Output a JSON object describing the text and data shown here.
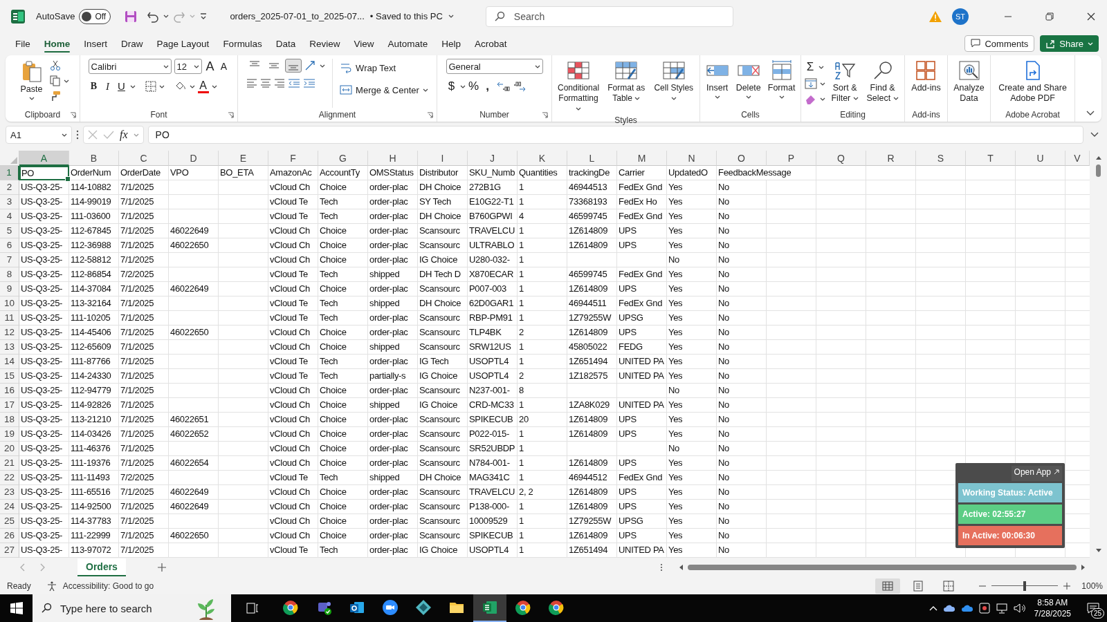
{
  "title_bar": {
    "autosave_label": "AutoSave",
    "autosave_on": false,
    "autosave_state": "Off",
    "file_name": "orders_2025-07-01_to_2025-07...",
    "save_status": "• Saved to this PC",
    "search_placeholder": "Search",
    "user_initials": "ST"
  },
  "menu_tabs": [
    {
      "label": "File",
      "selected": false
    },
    {
      "label": "Home",
      "selected": true
    },
    {
      "label": "Insert",
      "selected": false
    },
    {
      "label": "Draw",
      "selected": false
    },
    {
      "label": "Page Layout",
      "selected": false
    },
    {
      "label": "Formulas",
      "selected": false
    },
    {
      "label": "Data",
      "selected": false
    },
    {
      "label": "Review",
      "selected": false
    },
    {
      "label": "View",
      "selected": false
    },
    {
      "label": "Automate",
      "selected": false
    },
    {
      "label": "Help",
      "selected": false
    },
    {
      "label": "Acrobat",
      "selected": false
    }
  ],
  "comments_button": "Comments",
  "share_button": "Share",
  "ribbon": [
    {
      "kind": "clipboard",
      "label": "Clipboard",
      "paste": "Paste"
    },
    {
      "kind": "font",
      "label": "Font",
      "font_name": "Calibri",
      "font_size": "12",
      "grow": "A",
      "shrink": "A",
      "bold": "B",
      "italic": "I",
      "underline": "U",
      "font_color": "A"
    },
    {
      "kind": "alignment",
      "label": "Alignment",
      "vertical_align": [
        {
          "selected": false
        },
        {
          "selected": false
        },
        {
          "selected": true
        }
      ],
      "wrap_text": "Wrap Text",
      "merge_center": "Merge & Center"
    },
    {
      "kind": "number",
      "label": "Number",
      "format": "General",
      "currency": "$",
      "percent": "%",
      "comma": ","
    },
    {
      "kind": "styles",
      "label": "Styles",
      "buttons": [
        "Conditional Formatting",
        "Format as Table",
        "Cell Styles"
      ]
    },
    {
      "kind": "cells",
      "label": "Cells",
      "buttons": [
        "Insert",
        "Delete",
        "Format"
      ]
    },
    {
      "kind": "editing",
      "label": "Editing",
      "autosum": "Σ",
      "buttons": [
        "Sort & Filter",
        "Find & Select"
      ]
    },
    {
      "kind": "addins",
      "label": "Add-ins",
      "button": "Add-ins"
    },
    {
      "kind": "analyze",
      "button": "Analyze Data"
    },
    {
      "kind": "acrobat",
      "label": "Adobe Acrobat",
      "button": "Create and Share Adobe PDF"
    }
  ],
  "formula_bar": {
    "name_box": "A1",
    "fx": "fx",
    "content": "PO"
  },
  "sheet": {
    "columns": [
      {
        "label": "A",
        "selected": true
      },
      {
        "label": "B",
        "selected": false
      },
      {
        "label": "C",
        "selected": false
      },
      {
        "label": "D",
        "selected": false
      },
      {
        "label": "E",
        "selected": false
      },
      {
        "label": "F",
        "selected": false
      },
      {
        "label": "G",
        "selected": false
      },
      {
        "label": "H",
        "selected": false
      },
      {
        "label": "I",
        "selected": false
      },
      {
        "label": "J",
        "selected": false
      },
      {
        "label": "K",
        "selected": false
      },
      {
        "label": "L",
        "selected": false
      },
      {
        "label": "M",
        "selected": false
      },
      {
        "label": "N",
        "selected": false
      },
      {
        "label": "O",
        "selected": false
      },
      {
        "label": "P",
        "selected": false
      },
      {
        "label": "Q",
        "selected": false
      },
      {
        "label": "R",
        "selected": false
      },
      {
        "label": "S",
        "selected": false
      },
      {
        "label": "T",
        "selected": false
      },
      {
        "label": "U",
        "selected": false
      },
      {
        "label": "V",
        "selected": false
      }
    ],
    "rows": [
      {
        "number": "1",
        "selected": true,
        "cells": [
          "PO",
          "OrderNum",
          "OrderDate",
          "VPO",
          "BO_ETA",
          "AmazonAc",
          "AccountTy",
          "OMSStatus",
          "Distributor",
          "SKU_Numb",
          "Quantities",
          "trackingDe",
          "Carrier",
          "UpdatedO",
          "FeedbackMessage"
        ]
      },
      {
        "number": "2",
        "selected": false,
        "cells": [
          "US-Q3-25-",
          "114-10882",
          "7/1/2025",
          null,
          null,
          "vCloud Ch",
          "Choice",
          "order-plac",
          "DH Choice",
          "272B1G",
          "1",
          "46944513",
          "FedEx Gnd",
          "Yes",
          "No"
        ]
      },
      {
        "number": "3",
        "selected": false,
        "cells": [
          "US-Q3-25-",
          "114-99019",
          "7/1/2025",
          null,
          null,
          "vCloud Te",
          "Tech",
          "order-plac",
          "SY Tech",
          "E10G22-T1",
          "1",
          "73368193",
          "FedEx Ho",
          "Yes",
          "No"
        ]
      },
      {
        "number": "4",
        "selected": false,
        "cells": [
          "US-Q3-25-",
          "111-03600",
          "7/1/2025",
          null,
          null,
          "vCloud Te",
          "Tech",
          "order-plac",
          "DH Choice",
          "B760GPWI",
          "4",
          "46599745",
          "FedEx Gnd",
          "Yes",
          "No"
        ]
      },
      {
        "number": "5",
        "selected": false,
        "cells": [
          "US-Q3-25-",
          "112-67845",
          "7/1/2025",
          "46022649",
          null,
          "vCloud Ch",
          "Choice",
          "order-plac",
          "Scansourc",
          "TRAVELCU",
          "1",
          "1Z614809",
          "UPS",
          "Yes",
          "No"
        ]
      },
      {
        "number": "6",
        "selected": false,
        "cells": [
          "US-Q3-25-",
          "112-36988",
          "7/1/2025",
          "46022650",
          null,
          "vCloud Ch",
          "Choice",
          "order-plac",
          "Scansourc",
          "ULTRABLO",
          "1",
          "1Z614809",
          "UPS",
          "Yes",
          "No"
        ]
      },
      {
        "number": "7",
        "selected": false,
        "cells": [
          "US-Q3-25-",
          "112-58812",
          "7/1/2025",
          null,
          null,
          "vCloud Ch",
          "Choice",
          "order-plac",
          "IG Choice",
          "U280-032-",
          "1",
          null,
          null,
          "No",
          "No"
        ]
      },
      {
        "number": "8",
        "selected": false,
        "cells": [
          "US-Q3-25-",
          "112-86854",
          "7/2/2025",
          null,
          null,
          "vCloud Te",
          "Tech",
          "shipped",
          "DH Tech D",
          "X870ECAR",
          "1",
          "46599745",
          "FedEx Gnd",
          "Yes",
          "No"
        ]
      },
      {
        "number": "9",
        "selected": false,
        "cells": [
          "US-Q3-25-",
          "114-37084",
          "7/1/2025",
          "46022649",
          null,
          "vCloud Ch",
          "Choice",
          "order-plac",
          "Scansourc",
          "P007-003",
          "1",
          "1Z614809",
          "UPS",
          "Yes",
          "No"
        ]
      },
      {
        "number": "10",
        "selected": false,
        "cells": [
          "US-Q3-25-",
          "113-32164",
          "7/1/2025",
          null,
          null,
          "vCloud Te",
          "Tech",
          "shipped",
          "DH Choice",
          "62D0GAR1",
          "1",
          "46944511",
          "FedEx Gnd",
          "Yes",
          "No"
        ]
      },
      {
        "number": "11",
        "selected": false,
        "cells": [
          "US-Q3-25-",
          "111-10205",
          "7/1/2025",
          null,
          null,
          "vCloud Te",
          "Tech",
          "order-plac",
          "Scansourc",
          "RBP-PM91",
          "1",
          "1Z79255W",
          "UPSG",
          "Yes",
          "No"
        ]
      },
      {
        "number": "12",
        "selected": false,
        "cells": [
          "US-Q3-25-",
          "114-45406",
          "7/1/2025",
          "46022650",
          null,
          "vCloud Ch",
          "Choice",
          "order-plac",
          "Scansourc",
          "TLP4BK",
          "2",
          "1Z614809",
          "UPS",
          "Yes",
          "No"
        ]
      },
      {
        "number": "13",
        "selected": false,
        "cells": [
          "US-Q3-25-",
          "112-65609",
          "7/1/2025",
          null,
          null,
          "vCloud Ch",
          "Choice",
          "shipped",
          "Scansourc",
          "SRW12US",
          "1",
          "45805022",
          "FEDG",
          "Yes",
          "No"
        ]
      },
      {
        "number": "14",
        "selected": false,
        "cells": [
          "US-Q3-25-",
          "111-87766",
          "7/1/2025",
          null,
          null,
          "vCloud Te",
          "Tech",
          "order-plac",
          "IG Tech",
          "USOPTL4",
          "1",
          "1Z651494",
          "UNITED PA",
          "Yes",
          "No"
        ]
      },
      {
        "number": "15",
        "selected": false,
        "cells": [
          "US-Q3-25-",
          "114-24330",
          "7/1/2025",
          null,
          null,
          "vCloud Te",
          "Tech",
          "partially-s",
          "IG Choice",
          "USOPTL4",
          "2",
          "1Z182575",
          "UNITED PA",
          "Yes",
          "No"
        ]
      },
      {
        "number": "16",
        "selected": false,
        "cells": [
          "US-Q3-25-",
          "112-94779",
          "7/1/2025",
          null,
          null,
          "vCloud Ch",
          "Choice",
          "order-plac",
          "Scansourc",
          "N237-001-",
          "8",
          null,
          null,
          "No",
          "No"
        ]
      },
      {
        "number": "17",
        "selected": false,
        "cells": [
          "US-Q3-25-",
          "114-92826",
          "7/1/2025",
          null,
          null,
          "vCloud Ch",
          "Choice",
          "shipped",
          "IG Choice",
          "CRD-MC33",
          "1",
          "1ZA8K029",
          "UNITED PA",
          "Yes",
          "No"
        ]
      },
      {
        "number": "18",
        "selected": false,
        "cells": [
          "US-Q3-25-",
          "113-21210",
          "7/1/2025",
          "46022651",
          null,
          "vCloud Ch",
          "Choice",
          "order-plac",
          "Scansourc",
          "SPIKECUB",
          "20",
          "1Z614809",
          "UPS",
          "Yes",
          "No"
        ]
      },
      {
        "number": "19",
        "selected": false,
        "cells": [
          "US-Q3-25-",
          "114-03426",
          "7/1/2025",
          "46022652",
          null,
          "vCloud Ch",
          "Choice",
          "order-plac",
          "Scansourc",
          "P022-015-",
          "1",
          "1Z614809",
          "UPS",
          "Yes",
          "No"
        ]
      },
      {
        "number": "20",
        "selected": false,
        "cells": [
          "US-Q3-25-",
          "111-46376",
          "7/1/2025",
          null,
          null,
          "vCloud Ch",
          "Choice",
          "order-plac",
          "Scansourc",
          "SR52UBDP",
          "1",
          null,
          null,
          "No",
          "No"
        ]
      },
      {
        "number": "21",
        "selected": false,
        "cells": [
          "US-Q3-25-",
          "111-19376",
          "7/1/2025",
          "46022654",
          null,
          "vCloud Ch",
          "Choice",
          "order-plac",
          "Scansourc",
          "N784-001-",
          "1",
          "1Z614809",
          "UPS",
          "Yes",
          "No"
        ]
      },
      {
        "number": "22",
        "selected": false,
        "cells": [
          "US-Q3-25-",
          "111-11493",
          "7/2/2025",
          null,
          null,
          "vCloud Te",
          "Tech",
          "shipped",
          "DH Choice",
          "MAG341C",
          "1",
          "46944512",
          "FedEx Gnd",
          "Yes",
          "No"
        ]
      },
      {
        "number": "23",
        "selected": false,
        "cells": [
          "US-Q3-25-",
          "111-65516",
          "7/1/2025",
          "46022649",
          null,
          "vCloud Ch",
          "Choice",
          "order-plac",
          "Scansourc",
          "TRAVELCU",
          "2, 2",
          "1Z614809",
          "UPS",
          "Yes",
          "No"
        ]
      },
      {
        "number": "24",
        "selected": false,
        "cells": [
          "US-Q3-25-",
          "114-92500",
          "7/1/2025",
          "46022649",
          null,
          "vCloud Ch",
          "Choice",
          "order-plac",
          "Scansourc",
          "P138-000-",
          "1",
          "1Z614809",
          "UPS",
          "Yes",
          "No"
        ]
      },
      {
        "number": "25",
        "selected": false,
        "cells": [
          "US-Q3-25-",
          "114-37783",
          "7/1/2025",
          null,
          null,
          "vCloud Ch",
          "Choice",
          "order-plac",
          "Scansourc",
          "10009529",
          "1",
          "1Z79255W",
          "UPSG",
          "Yes",
          "No"
        ]
      },
      {
        "number": "26",
        "selected": false,
        "cells": [
          "US-Q3-25-",
          "111-22999",
          "7/1/2025",
          "46022650",
          null,
          "vCloud Ch",
          "Choice",
          "order-plac",
          "Scansourc",
          "SPIKECUB",
          "1",
          "1Z614809",
          "UPS",
          "Yes",
          "No"
        ]
      },
      {
        "number": "27",
        "selected": false,
        "cells": [
          "US-Q3-25-",
          "113-97072",
          "7/1/2025",
          null,
          null,
          "vCloud Te",
          "Tech",
          "order-plac",
          "IG Choice",
          "USOPTL4",
          "1",
          "1Z651494",
          "UNITED PA",
          "Yes",
          "No"
        ]
      }
    ]
  },
  "sheet_tabs": [
    {
      "label": "Orders",
      "selected": true
    }
  ],
  "status_bar": {
    "ready": "Ready",
    "accessibility": "Accessibility: Good to go",
    "views": [
      {
        "selected": true
      },
      {
        "selected": false
      },
      {
        "selected": false
      }
    ],
    "zoom": {
      "level": 0.5
    },
    "zoom_percent": "100%"
  },
  "widget": {
    "open_app": "Open App",
    "items": [
      {
        "text": "Working Status: Active",
        "color": "#7dc3cf"
      },
      {
        "text": "Active: 02:55:27",
        "color": "#5ccd85"
      },
      {
        "text": "In Active: 00:06:30",
        "color": "#e6705d"
      }
    ]
  },
  "taskbar": {
    "search_placeholder": "Type here to search",
    "apps": [
      {
        "kind": "browser",
        "selected": false
      },
      {
        "kind": "chat",
        "selected": false
      },
      {
        "kind": "mail",
        "selected": false
      },
      {
        "kind": "video",
        "selected": false
      },
      {
        "kind": "diamond",
        "selected": false
      },
      {
        "kind": "folder",
        "selected": false
      },
      {
        "kind": "sheet",
        "selected": true
      },
      {
        "kind": "browser",
        "selected": false
      },
      {
        "kind": "browser",
        "selected": false
      }
    ],
    "time": "8:58 AM",
    "date": "7/28/2025",
    "notifications": "25"
  }
}
